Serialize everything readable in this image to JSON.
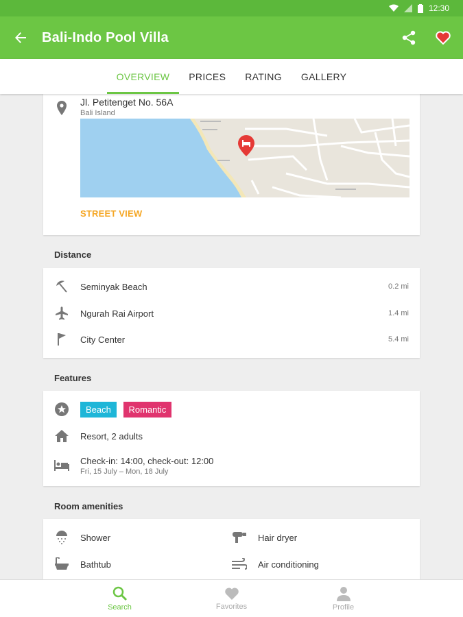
{
  "status": {
    "time": "12:30"
  },
  "appbar": {
    "title": "Bali-Indo Pool Villa"
  },
  "tabs": [
    {
      "label": "OVERVIEW",
      "active": true
    },
    {
      "label": "PRICES",
      "active": false
    },
    {
      "label": "RATING",
      "active": false
    },
    {
      "label": "GALLERY",
      "active": false
    }
  ],
  "location": {
    "address": "Jl. Petitenget No. 56A",
    "region": "Bali Island",
    "street_view": "STREET VIEW"
  },
  "distance": {
    "title": "Distance",
    "items": [
      {
        "label": "Seminyak Beach",
        "value": "0.2 mi",
        "icon": "beach-umbrella-icon"
      },
      {
        "label": "Ngurah Rai Airport",
        "value": "1.4 mi",
        "icon": "airplane-icon"
      },
      {
        "label": "City Center",
        "value": "5.4 mi",
        "icon": "flag-icon"
      }
    ]
  },
  "features": {
    "title": "Features",
    "tags": [
      {
        "label": "Beach",
        "color": "#1eb6d8"
      },
      {
        "label": "Romantic",
        "color": "#e0346e"
      }
    ],
    "room": "Resort, 2 adults",
    "checkin": "Check-in: 14:00, check-out: 12:00",
    "dates": "Fri, 15 July – Mon, 18 July"
  },
  "amenities": {
    "title": "Room amenities",
    "items": [
      {
        "label": "Shower",
        "icon": "shower-icon"
      },
      {
        "label": "Hair dryer",
        "icon": "hair-dryer-icon"
      },
      {
        "label": "Bathtub",
        "icon": "bathtub-icon"
      },
      {
        "label": "Air conditioning",
        "icon": "air-conditioning-icon"
      }
    ]
  },
  "bottomnav": [
    {
      "label": "Search",
      "active": true
    },
    {
      "label": "Favorites",
      "active": false
    },
    {
      "label": "Profile",
      "active": false
    }
  ],
  "colors": {
    "primary": "#6cc644",
    "accent": "#f5a623",
    "pin": "#e53935"
  }
}
